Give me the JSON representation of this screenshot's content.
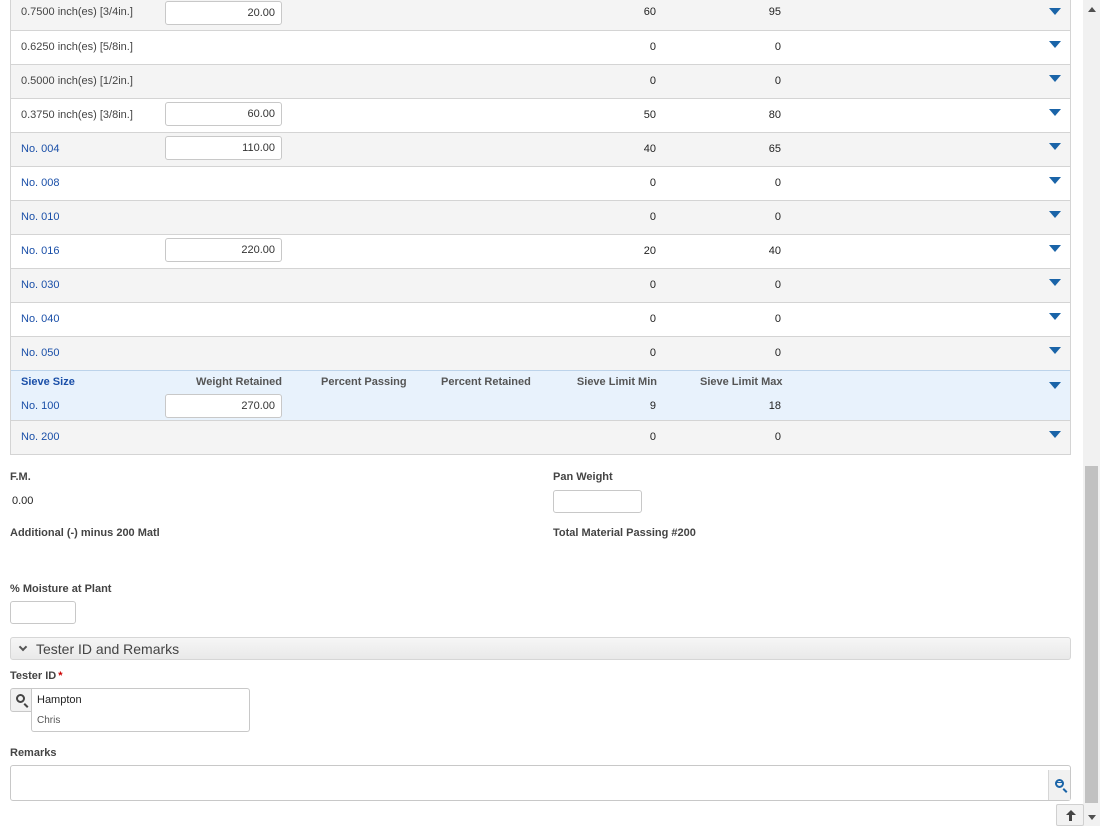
{
  "table": {
    "headers": {
      "sieve_size": "Sieve Size",
      "weight_retained": "Weight Retained",
      "percent_passing": "Percent Passing",
      "percent_retained": "Percent Retained",
      "sieve_limit_min": "Sieve Limit Min",
      "sieve_limit_max": "Sieve Limit Max"
    },
    "rows": [
      {
        "sieve": "0.7500 inch(es) [3/4in.]",
        "weight": "20.00",
        "min": "60",
        "max": "95"
      },
      {
        "sieve": "0.6250 inch(es) [5/8in.]",
        "weight": "",
        "min": "0",
        "max": "0"
      },
      {
        "sieve": "0.5000 inch(es) [1/2in.]",
        "weight": "",
        "min": "0",
        "max": "0"
      },
      {
        "sieve": "0.3750 inch(es) [3/8in.]",
        "weight": "60.00",
        "min": "50",
        "max": "80"
      },
      {
        "sieve": "No. 004",
        "weight": "110.00",
        "min": "40",
        "max": "65"
      },
      {
        "sieve": "No. 008",
        "weight": "",
        "min": "0",
        "max": "0"
      },
      {
        "sieve": "No. 010",
        "weight": "",
        "min": "0",
        "max": "0"
      },
      {
        "sieve": "No. 016",
        "weight": "220.00",
        "min": "20",
        "max": "40"
      },
      {
        "sieve": "No. 030",
        "weight": "",
        "min": "0",
        "max": "0"
      },
      {
        "sieve": "No. 040",
        "weight": "",
        "min": "0",
        "max": "0"
      },
      {
        "sieve": "No. 050",
        "weight": "",
        "min": "0",
        "max": "0"
      },
      {
        "sieve": "No. 100",
        "weight": "270.00",
        "min": "9",
        "max": "18"
      },
      {
        "sieve": "No. 200",
        "weight": "",
        "min": "0",
        "max": "0"
      }
    ]
  },
  "form": {
    "fm_label": "F.M.",
    "fm_value": "0.00",
    "pan_weight_label": "Pan Weight",
    "pan_weight_value": "",
    "additional_minus_label": "Additional (-) minus 200 Matl",
    "total_passing_label": "Total Material Passing #200",
    "moisture_label": "% Moisture at Plant",
    "moisture_value": ""
  },
  "section": {
    "title": "Tester ID and Remarks",
    "tester_label": "Tester ID",
    "required_mark": "*",
    "tester_last": "Hampton",
    "tester_first": "Chris",
    "remarks_label": "Remarks",
    "remarks_value": ""
  },
  "colors": {
    "link": "#1a4fa8",
    "accent": "#1a64a8",
    "highlight_row": "#e8f2fc"
  }
}
